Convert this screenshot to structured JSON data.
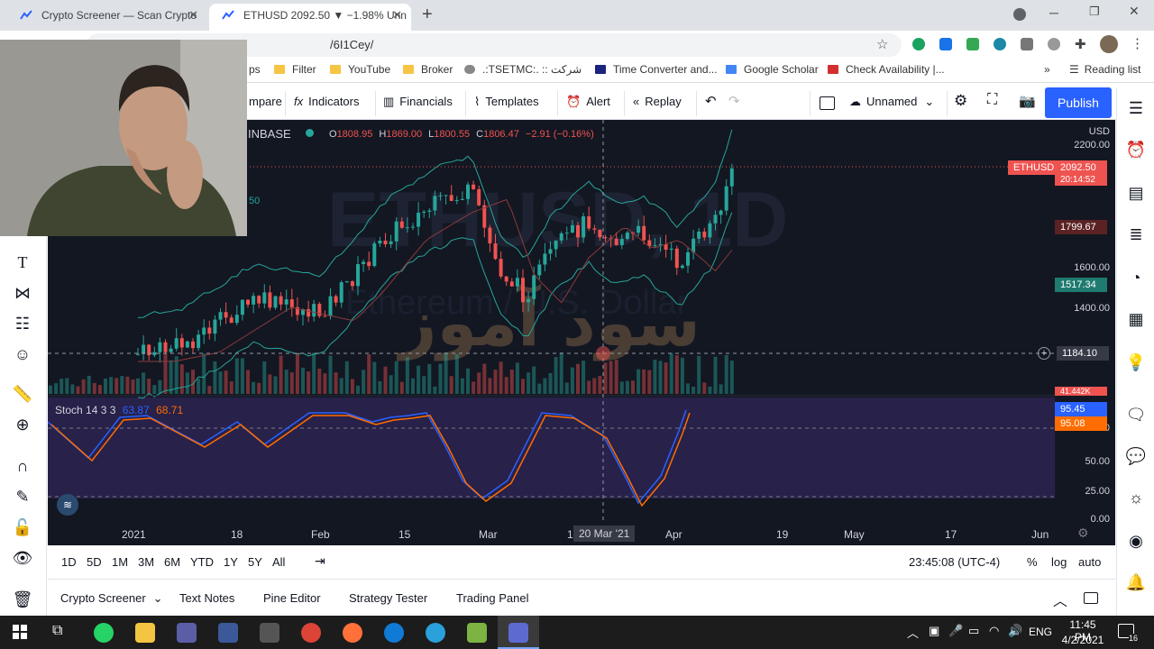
{
  "browser": {
    "tabs": [
      {
        "title": "Crypto Screener — Scan Crypto"
      },
      {
        "title": "ETHUSD 2092.50 ▼ −1.98% Unn"
      }
    ],
    "url": "/6I1Cey/",
    "bookmarks": [
      "ps",
      "Filter",
      "YouTube",
      "Broker",
      ".:TSETMC:. :: شرکت",
      "Time Converter and...",
      "Google Scholar",
      "Check Availability |...",
      "Reading list"
    ]
  },
  "toolbar": {
    "compare": "mpare",
    "indicators": "Indicators",
    "financials": "Financials",
    "templates": "Templates",
    "alert": "Alert",
    "replay": "Replay",
    "layout_name": "Unnamed",
    "publish": "Publish"
  },
  "legend": {
    "exchange": "INBASE",
    "o_label": "O",
    "o": "1808.95",
    "h_label": "H",
    "h": "1869.00",
    "l_label": "L",
    "l": "1800.55",
    "c_label": "C",
    "c": "1806.47",
    "change": "−2.91 (−0.16%)",
    "ma_value": "50"
  },
  "watermark": {
    "symbol": "ETHUSD, 1D",
    "name": "Ethereum / U.S. Dollar",
    "brand": "سود آموز"
  },
  "price_scale": {
    "currency": "USD",
    "labels": [
      "2200.00",
      "1600.00",
      "1400.00"
    ],
    "last_price_symbol": "ETHUSD",
    "last_price": "2092.50",
    "countdown": "20:14:52",
    "upper_band": "1799.67",
    "lower_band": "1517.34",
    "crosshair_price": "1184.10",
    "volume": "41.442K"
  },
  "stoch": {
    "name": "Stoch 14 3 3",
    "k": "63.87",
    "d": "68.71",
    "k_last": "95.45",
    "d_last": "95.08",
    "labels": [
      "75.00",
      "50.00",
      "25.00",
      "0.00"
    ]
  },
  "time_scale": {
    "labels": [
      "2021",
      "18",
      "Feb",
      "15",
      "Mar",
      "1",
      "Apr",
      "19",
      "May",
      "17",
      "Jun"
    ],
    "crosshair_date": "20 Mar '21"
  },
  "ranges": [
    "1D",
    "5D",
    "1M",
    "3M",
    "6M",
    "YTD",
    "1Y",
    "5Y",
    "All"
  ],
  "clock": "23:45:08 (UTC-4)",
  "scale_options": [
    "%",
    "log",
    "auto"
  ],
  "panels": [
    "Crypto Screener",
    "Text Notes",
    "Pine Editor",
    "Strategy Tester",
    "Trading Panel"
  ],
  "taskbar": {
    "language": "ENG",
    "time": "11:45 PM",
    "date": "4/2/2021",
    "notif_count": "16"
  },
  "colors": {
    "up": "#26a69a",
    "down": "#ef5350",
    "bg": "#131722",
    "stoch_k": "#2962ff",
    "stoch_d": "#ff6d00",
    "band": "#26a69a",
    "ma": "#8b3a3a",
    "accent": "#2962ff"
  }
}
